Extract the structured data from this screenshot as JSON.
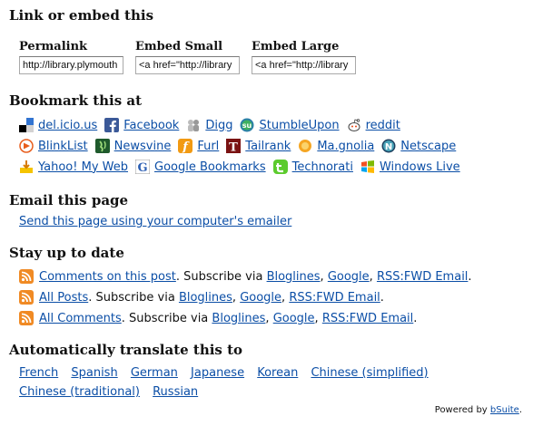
{
  "sections": {
    "embed_title": "Link or embed this",
    "bookmark_title": "Bookmark this at",
    "email_title": "Email this page",
    "stay_title": "Stay up to date",
    "translate_title": "Automatically translate this to"
  },
  "embed": {
    "permalink_label": "Permalink",
    "permalink_value": "http://library.plymouth",
    "small_label": "Embed Small",
    "small_value": "<a href=\"http://library",
    "large_label": "Embed Large",
    "large_value": "<a href=\"http://library"
  },
  "bookmarks": {
    "delicious": "del.icio.us",
    "facebook": "Facebook",
    "digg": "Digg",
    "stumbleupon": "StumbleUpon",
    "reddit": "reddit",
    "blinklist": "BlinkList",
    "newsvine": "Newsvine",
    "furl": "Furl",
    "tailrank": "Tailrank",
    "magnolia": "Ma.gnolia",
    "netscape": "Netscape",
    "yahoo": "Yahoo! My Web",
    "google": "Google Bookmarks",
    "technorati": "Technorati",
    "windowslive": "Windows Live"
  },
  "email": {
    "link": "Send this page using your computer's emailer"
  },
  "feeds": {
    "subscribe_via": "Subscribe via",
    "bloglines": "Bloglines",
    "google": "Google",
    "rssfwd": "RSS:FWD Email",
    "comma": ",",
    "period": ".",
    "items": [
      {
        "label": "Comments on this post"
      },
      {
        "label": "All Posts"
      },
      {
        "label": "All Comments"
      }
    ]
  },
  "translate": {
    "french": "French",
    "spanish": "Spanish",
    "german": "German",
    "japanese": "Japanese",
    "korean": "Korean",
    "chinese_simplified": "Chinese (simplified)",
    "chinese_traditional": "Chinese (traditional)",
    "russian": "Russian"
  },
  "footer": {
    "powered_by": "Powered by",
    "bsuite": "bSuite",
    "period": "."
  },
  "colors": {
    "link": "#0b4ea6",
    "rss": "#f08a24"
  }
}
